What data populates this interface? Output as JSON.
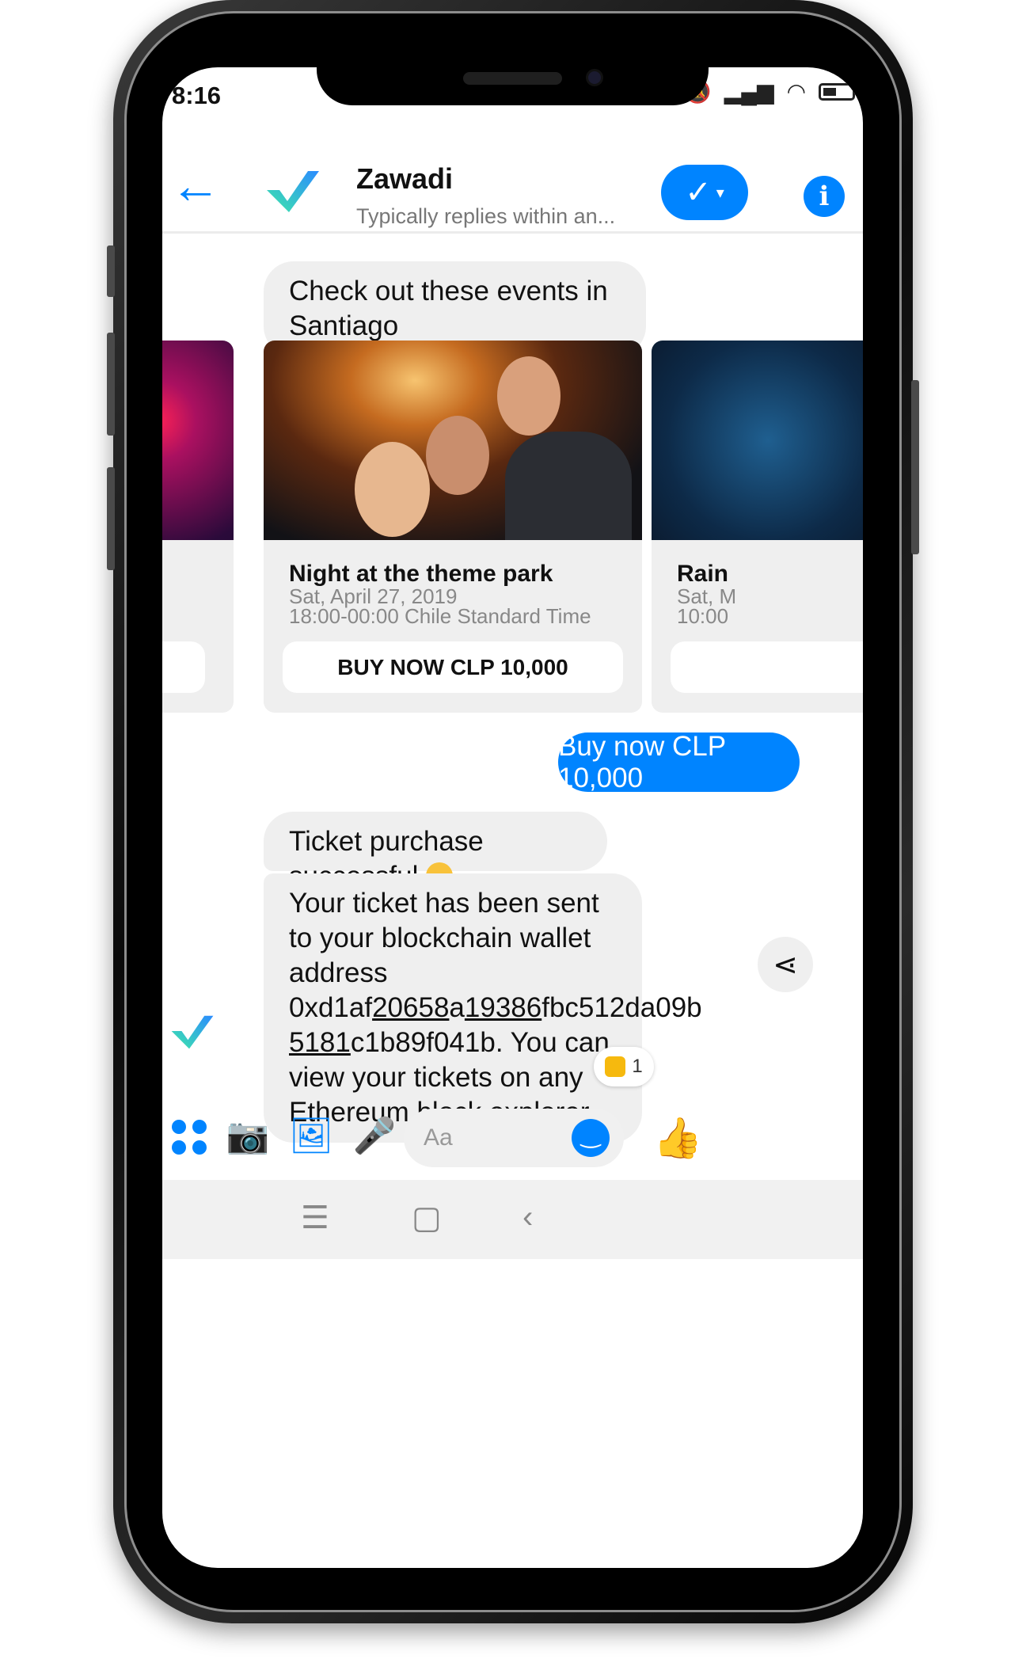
{
  "status_bar": {
    "time": "8:16"
  },
  "header": {
    "back_icon": "arrow-left",
    "title": "Zawadi",
    "subtitle": "Typically replies within an...",
    "brand_color": "#0084ff"
  },
  "messages": {
    "intro": "Check out these events in Santiago",
    "carousel": {
      "left_card": {},
      "main_card": {
        "title": "Night at the theme park",
        "date": "Sat, April 27, 2019",
        "time": "18:00-00:00 Chile Standard Time",
        "button": "BUY NOW CLP 10,000"
      },
      "right_card": {
        "title": "Rain",
        "date": "Sat, M",
        "time": "10:00"
      }
    },
    "outgoing": "Buy now CLP 10,000",
    "purchase_ok": "Ticket purchase successful",
    "purchase_ok_suffix": ".",
    "ticket_line1": "Your ticket has been sent to your blockchain wallet address 0xd1af",
    "addr_1": "20658",
    "addr_2": "a",
    "addr_3": "19386",
    "addr_4": "fbc512da09b",
    "addr_5": "5181",
    "ticket_line2": "c1b89f041b. You can view your tickets on any Ethereum block explorer.",
    "reaction_count": "1"
  },
  "composer": {
    "placeholder": "Aa"
  }
}
